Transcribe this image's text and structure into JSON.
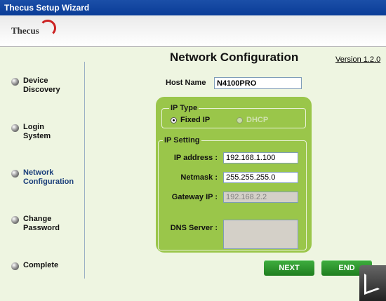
{
  "window": {
    "title": "Thecus Setup Wizard"
  },
  "brand": {
    "logo_text": "Thecus"
  },
  "sidebar": {
    "steps": [
      {
        "label_line1": "Device",
        "label_line2": "Discovery",
        "active": false
      },
      {
        "label_line1": "Login",
        "label_line2": "System",
        "active": false
      },
      {
        "label_line1": "Network",
        "label_line2": "Configuration",
        "active": true
      },
      {
        "label_line1": "Change",
        "label_line2": "Password",
        "active": false
      },
      {
        "label_line1": "Complete",
        "label_line2": "",
        "active": false
      }
    ]
  },
  "page": {
    "title": "Network Configuration",
    "version": "Version 1.2.0"
  },
  "form": {
    "host_name_label": "Host Name",
    "host_name_value": "N4100PRO",
    "ip_type": {
      "legend": "IP Type",
      "options": [
        {
          "label": "Fixed IP",
          "selected": true
        },
        {
          "label": "DHCP",
          "selected": false
        }
      ]
    },
    "ip_setting": {
      "legend": "IP Setting",
      "ip_address_label": "IP address :",
      "ip_address_value": "192.168.1.100",
      "netmask_label": "Netmask :",
      "netmask_value": "255.255.255.0",
      "gateway_label": "Gateway IP :",
      "gateway_value": "192.168.2.2",
      "dns_label": "DNS Server :",
      "dns_value": ""
    }
  },
  "buttons": {
    "next_label": "NEXT",
    "end_label": "END"
  },
  "colors": {
    "titlebar": "#0A3C97",
    "panel_green": "#9AC64A",
    "button_green": "#2E962E",
    "background": "#EEF5E1"
  }
}
